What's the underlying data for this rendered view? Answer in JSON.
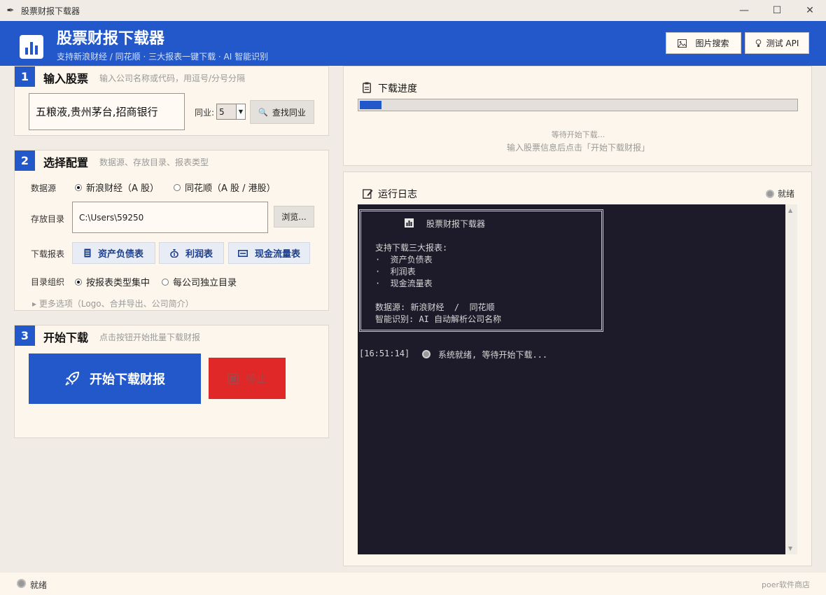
{
  "window": {
    "title": "股票财报下载器",
    "minimize_glyph": "—",
    "maximize_glyph": "☐",
    "close_glyph": "✕"
  },
  "header": {
    "title": "股票财报下载器",
    "subtitle": "支持新浪财经 / 同花顺  ·  三大报表一键下载  ·  AI 智能识别",
    "image_search_label": "图片搜索",
    "test_api_label": "测试 API"
  },
  "step1": {
    "number": "1",
    "title": "输入股票",
    "hint": "输入公司名称或代码，用逗号/分号分隔",
    "stock_input_value": "五粮液,贵州茅台,招商银行",
    "peer_label": "同业:",
    "peer_count_value": "5",
    "find_peers_label": "查找同业"
  },
  "step2": {
    "number": "2",
    "title": "选择配置",
    "hint": "数据源、存放目录、报表类型",
    "datasource_label": "数据源",
    "datasource_options": [
      {
        "label": "新浪财经（A 股）",
        "selected": true
      },
      {
        "label": "同花顺（A 股 / 港股）",
        "selected": false
      }
    ],
    "directory_label": "存放目录",
    "directory_value": "C:\\Users\\59250",
    "browse_label": "浏览...",
    "reports_label": "下载报表",
    "report_buttons": [
      "资产负债表",
      "利润表",
      "现金流量表"
    ],
    "dir_org_label": "目录组织",
    "dir_org_options": [
      {
        "label": "按报表类型集中",
        "selected": true
      },
      {
        "label": "每公司独立目录",
        "selected": false
      }
    ],
    "more_options_label": "▸  更多选项（Logo、合并导出、公司简介）"
  },
  "step3": {
    "number": "3",
    "title": "开始下载",
    "hint": "点击按钮开始批量下载财报",
    "start_label": "开始下载财报",
    "stop_label": "停止"
  },
  "progress": {
    "title": "下载进度",
    "fraction": 0.05,
    "waiting_text": "等待开始下载...",
    "instruction_text": "输入股票信息后点击「开始下载财报」"
  },
  "log": {
    "title": "运行日志",
    "status_label": "就绪",
    "banner_title": "股票财报下载器",
    "banner_lines": [
      "支持下载三大报表:",
      "·  资产负债表",
      "·  利润表",
      "·  现金流量表",
      "",
      "数据源: 新浪财经  /  同花顺",
      "智能识别: AI 自动解析公司名称"
    ],
    "entry_time": "[16:51:14]",
    "entry_text": "系统就绪, 等待开始下载..."
  },
  "statusbar": {
    "status_label": "就绪",
    "brand": "poer软件商店"
  },
  "colors": {
    "primary": "#2258c9",
    "stop": "#e02828",
    "terminal_bg": "#1d1b2a",
    "panel_bg": "#fdf6ec"
  }
}
